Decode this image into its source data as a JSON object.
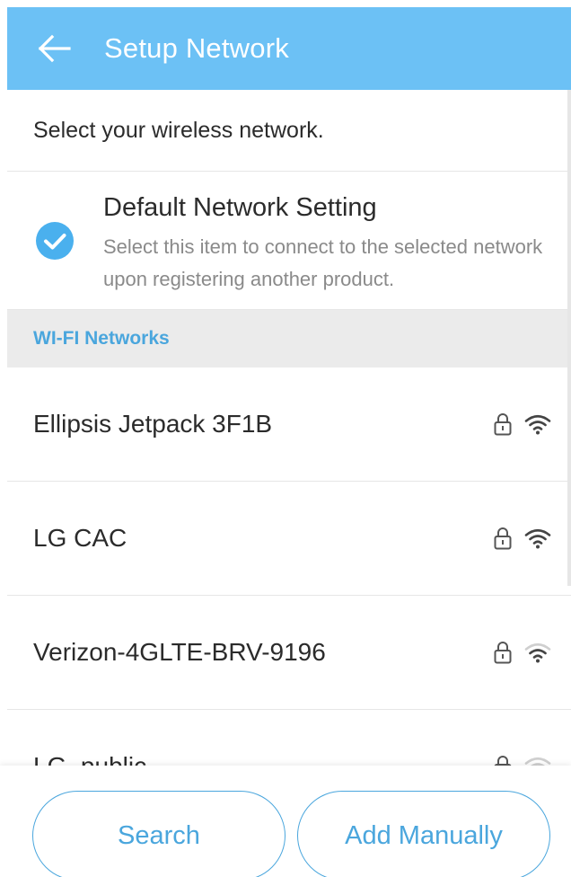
{
  "header": {
    "title": "Setup Network",
    "back_icon": "arrow-left-icon"
  },
  "instruction": "Select your wireless network.",
  "default_setting": {
    "checked": true,
    "title": "Default Network Setting",
    "description": "Select this item to connect to the selected network upon registering another product."
  },
  "section_header": "WI-FI Networks",
  "networks": [
    {
      "name": "Ellipsis Jetpack 3F1B",
      "secured": true,
      "signal": "full"
    },
    {
      "name": "LG CAC",
      "secured": true,
      "signal": "full"
    },
    {
      "name": "Verizon-4GLTE-BRV-9196",
      "secured": true,
      "signal": "medium"
    },
    {
      "name": "LG_public",
      "secured": true,
      "signal": "low"
    }
  ],
  "buttons": {
    "search": "Search",
    "add_manually": "Add Manually"
  },
  "colors": {
    "app_bar": "#6cc1f5",
    "accent": "#4aa6dd",
    "check": "#4ab0ee"
  }
}
